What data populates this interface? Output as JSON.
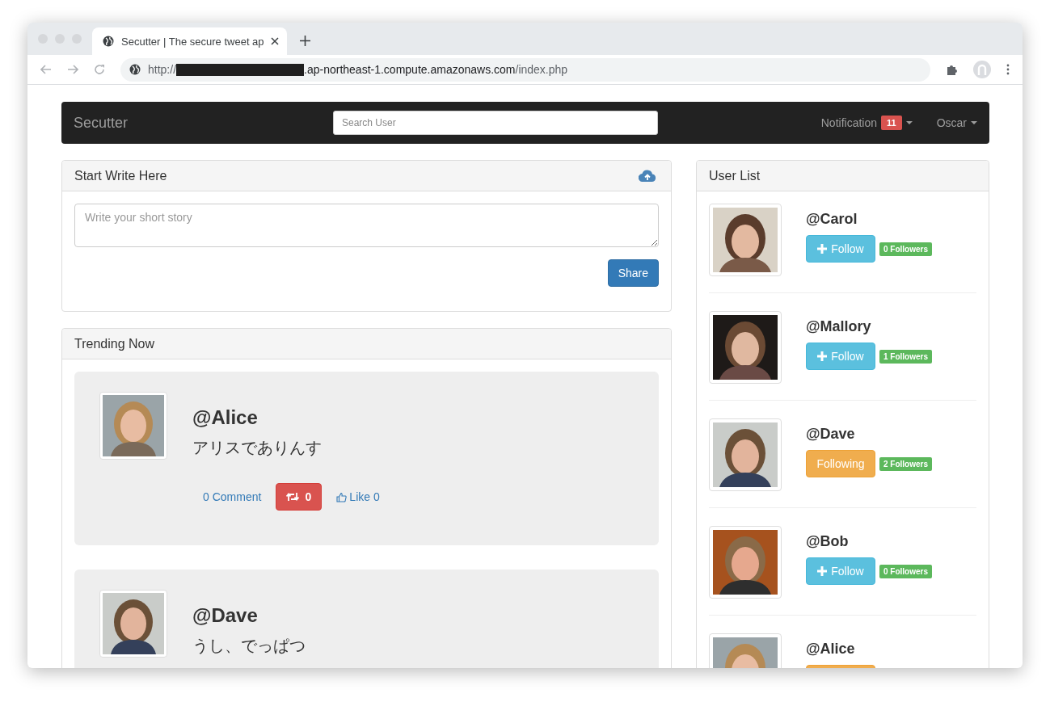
{
  "browser": {
    "tab": {
      "title": "Secutter | The secure tweet ap",
      "selected": true
    },
    "url": {
      "scheme": "http://",
      "host": ".ap-northeast-1.compute.amazonaws.com",
      "path": "/index.php"
    }
  },
  "navbar": {
    "brand": "Secutter",
    "search": {
      "placeholder": "Search User"
    },
    "notification": {
      "label": "Notification",
      "count": "11"
    },
    "user": "Oscar"
  },
  "compose": {
    "title": "Start Write Here",
    "placeholder": "Write your short story",
    "button": "Share"
  },
  "trending": {
    "title": "Trending Now",
    "posts": [
      {
        "author": "@Alice",
        "text": "アリスでありんす",
        "comments": "0 Comment",
        "retweets": "0",
        "likes": "Like 0"
      },
      {
        "author": "@Dave",
        "text": "うし、でっぱつ"
      }
    ]
  },
  "user_list": {
    "title": "User List",
    "users": [
      {
        "name": "@Carol",
        "following": false,
        "button": "Follow",
        "followers": "0 Followers"
      },
      {
        "name": "@Mallory",
        "following": false,
        "button": "Follow",
        "followers": "1 Followers"
      },
      {
        "name": "@Dave",
        "following": true,
        "button": "Following",
        "followers": "2 Followers"
      },
      {
        "name": "@Bob",
        "following": false,
        "button": "Follow",
        "followers": "0 Followers"
      },
      {
        "name": "@Alice",
        "following": true
      }
    ]
  }
}
